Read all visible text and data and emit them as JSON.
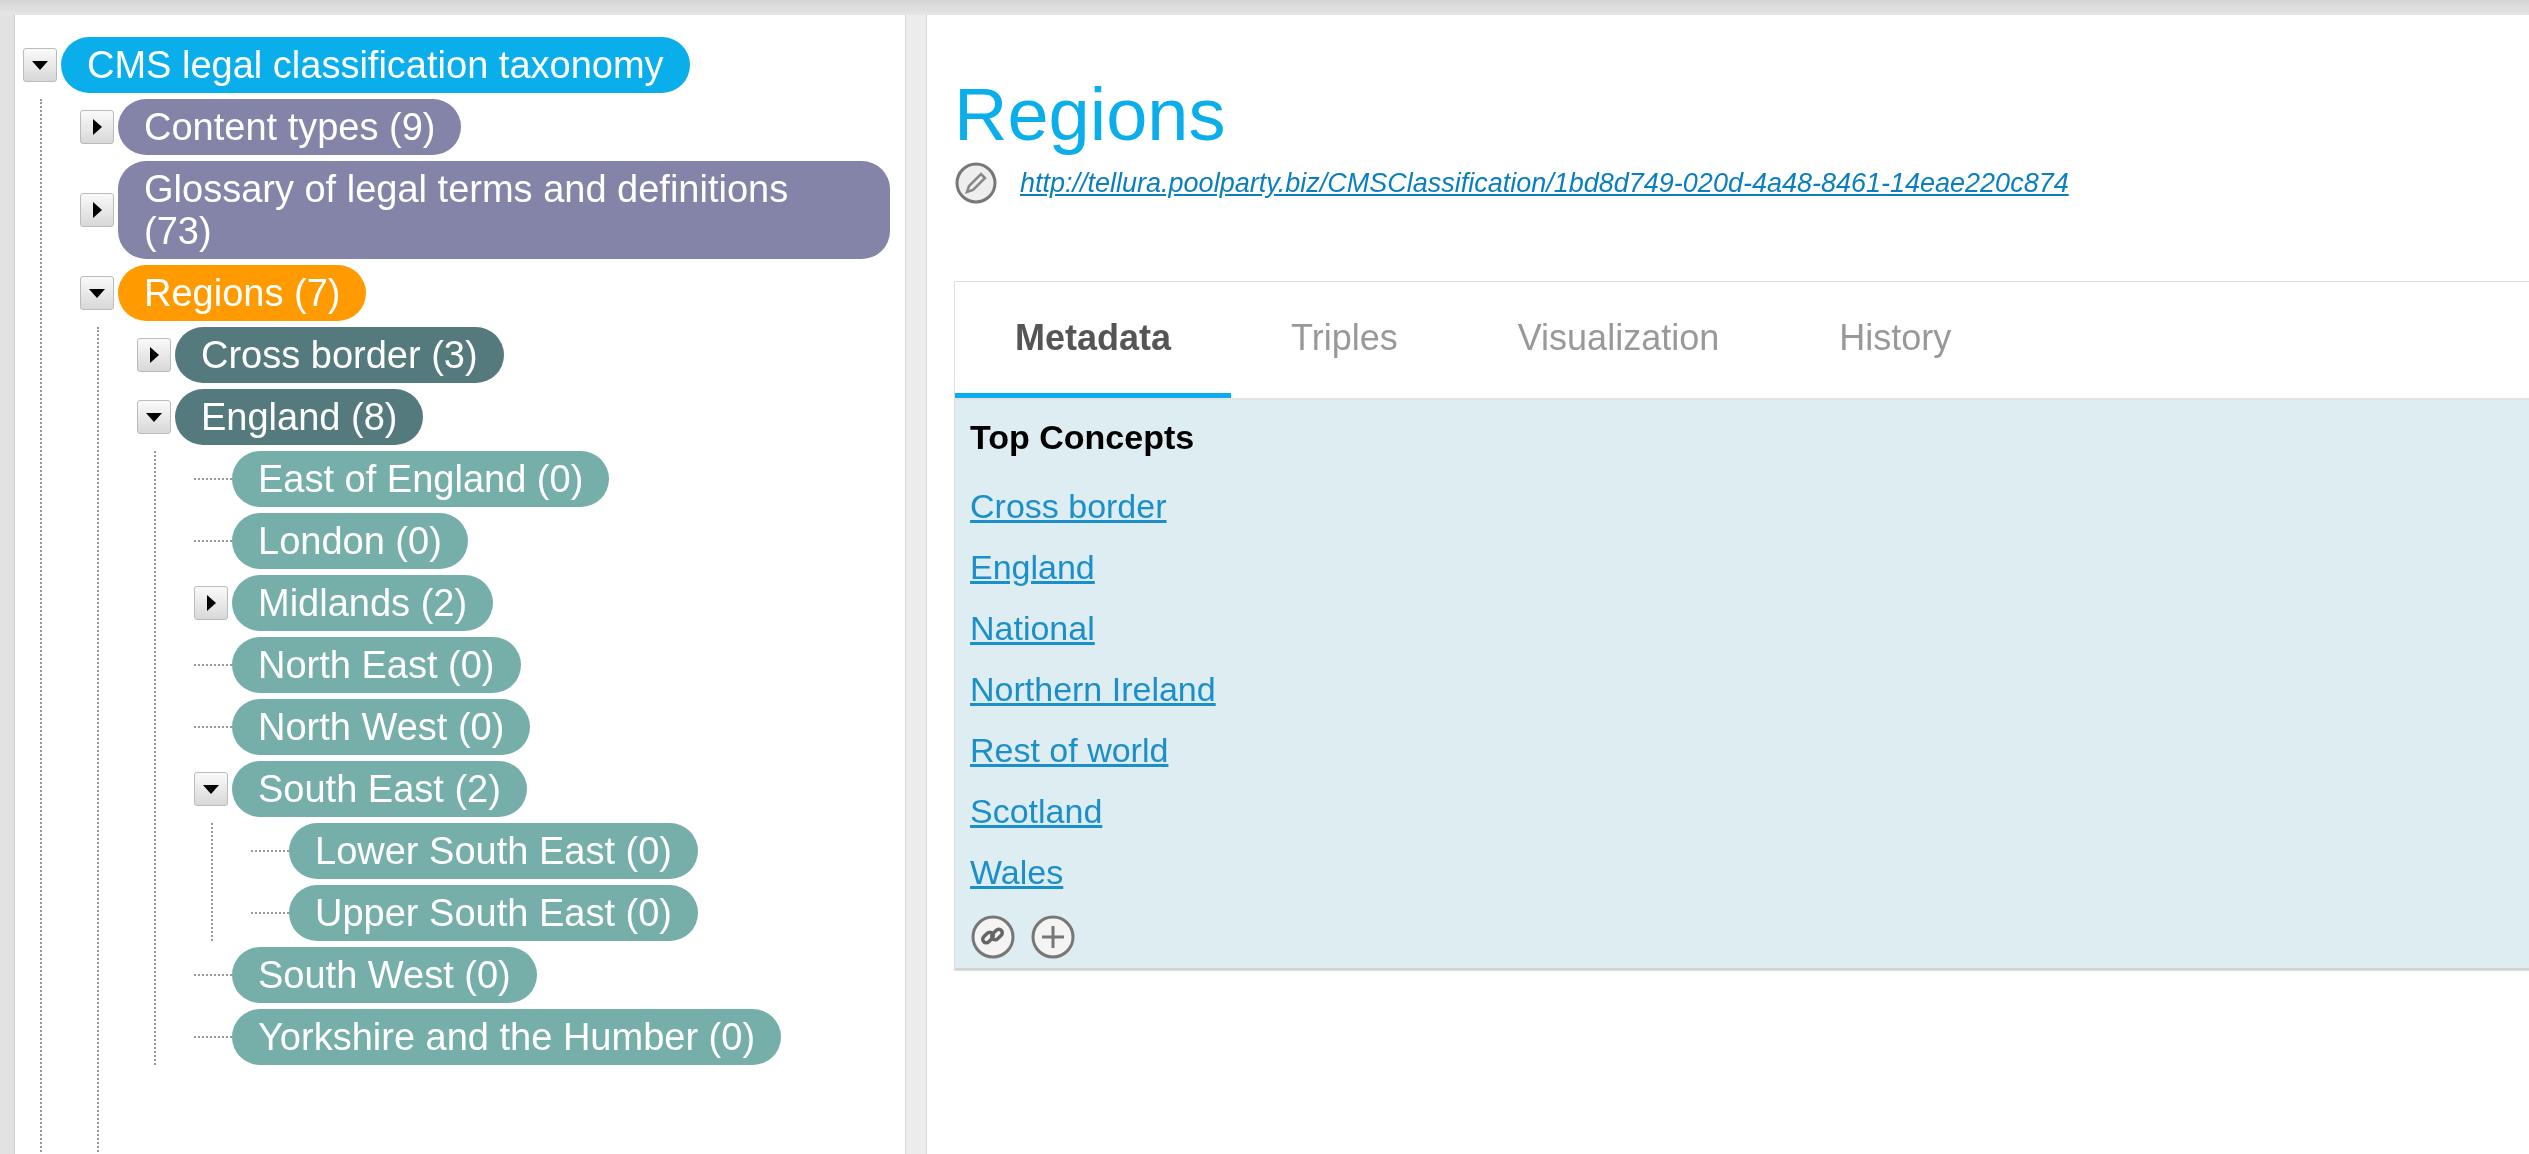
{
  "tree": [
    {
      "label": "CMS legal classification taxonomy",
      "color": "#0aaeea",
      "kind": "branch",
      "expanded": true,
      "children": [
        {
          "label": "Content types (9)",
          "color": "#8483a8",
          "kind": "branch",
          "expanded": false
        },
        {
          "label": "Glossary of legal terms and definitions (73)",
          "color": "#8483a8",
          "kind": "branch",
          "expanded": false
        },
        {
          "label": "Regions (7)",
          "color": "#ff9a00",
          "kind": "branch",
          "expanded": true,
          "children": [
            {
              "label": "Cross border (3)",
              "color": "#557a7d",
              "kind": "branch",
              "expanded": false
            },
            {
              "label": "England (8)",
              "color": "#557a7d",
              "kind": "branch",
              "expanded": true,
              "children": [
                {
                  "label": "East of England (0)",
                  "color": "#76afa9",
                  "kind": "leaf"
                },
                {
                  "label": "London (0)",
                  "color": "#76afa9",
                  "kind": "leaf"
                },
                {
                  "label": "Midlands (2)",
                  "color": "#76afa9",
                  "kind": "branch",
                  "expanded": false
                },
                {
                  "label": "North East (0)",
                  "color": "#76afa9",
                  "kind": "leaf"
                },
                {
                  "label": "North West (0)",
                  "color": "#76afa9",
                  "kind": "leaf"
                },
                {
                  "label": "South East (2)",
                  "color": "#76afa9",
                  "kind": "branch",
                  "expanded": true,
                  "children": [
                    {
                      "label": "Lower South East (0)",
                      "color": "#76afa9",
                      "kind": "leaf"
                    },
                    {
                      "label": "Upper South East (0)",
                      "color": "#76afa9",
                      "kind": "leaf"
                    }
                  ]
                },
                {
                  "label": "South West (0)",
                  "color": "#76afa9",
                  "kind": "leaf"
                },
                {
                  "label": "Yorkshire and the Humber (0)",
                  "color": "#76afa9",
                  "kind": "leaf"
                }
              ]
            }
          ]
        }
      ]
    }
  ],
  "concept": {
    "title": "Regions",
    "uri": "http://tellura.poolparty.biz/CMSClassification/1bd8d749-020d-4a48-8461-14eae220c874"
  },
  "tabs": [
    {
      "label": "Metadata",
      "selected": true
    },
    {
      "label": "Triples",
      "selected": false
    },
    {
      "label": "Visualization",
      "selected": false
    },
    {
      "label": "History",
      "selected": false
    }
  ],
  "metadata": {
    "heading": "Top Concepts",
    "links": [
      "Cross border",
      "England",
      "National",
      "Northern Ireland",
      "Rest of world",
      "Scotland",
      "Wales"
    ]
  }
}
